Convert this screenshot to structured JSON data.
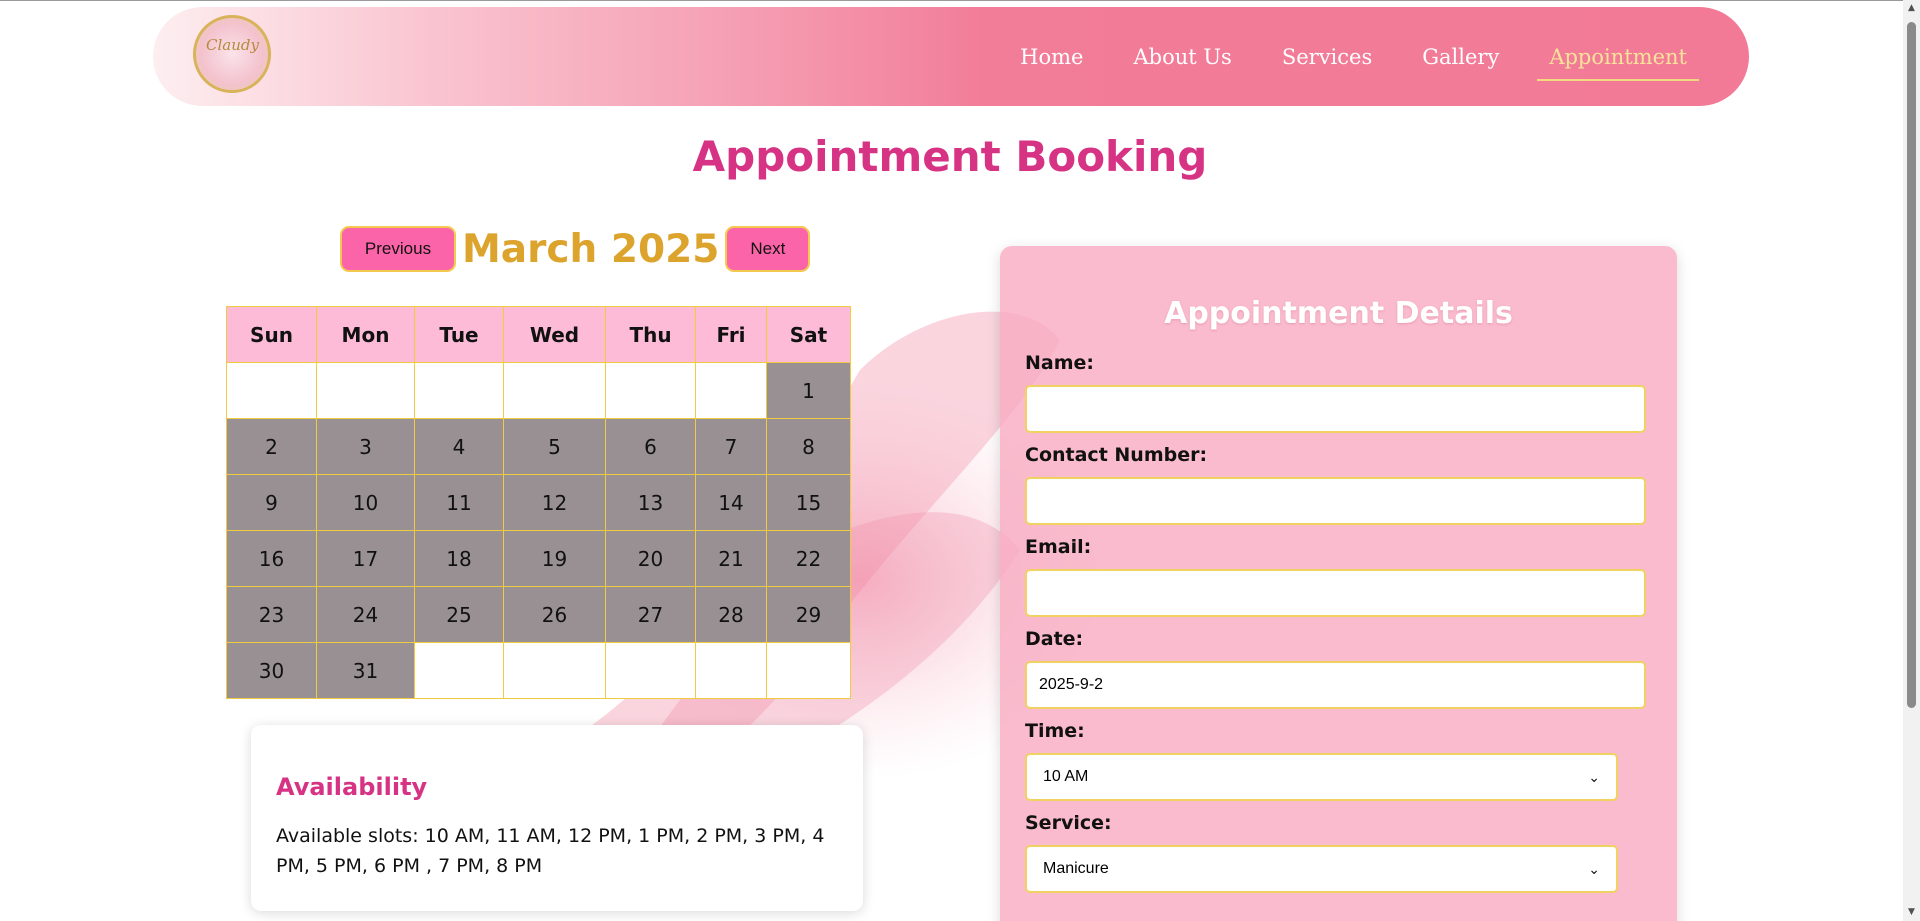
{
  "nav": {
    "logo_text": "Claudy",
    "links": [
      "Home",
      "About Us",
      "Services",
      "Gallery",
      "Appointment"
    ]
  },
  "page": {
    "title": "Appointment Booking"
  },
  "calendar": {
    "prev_label": "Previous",
    "next_label": "Next",
    "month_label": "March 2025",
    "weekdays": [
      "Sun",
      "Mon",
      "Tue",
      "Wed",
      "Thu",
      "Fri",
      "Sat"
    ],
    "weeks": [
      [
        "",
        "",
        "",
        "",
        "",
        "",
        "1"
      ],
      [
        "2",
        "3",
        "4",
        "5",
        "6",
        "7",
        "8"
      ],
      [
        "9",
        "10",
        "11",
        "12",
        "13",
        "14",
        "15"
      ],
      [
        "16",
        "17",
        "18",
        "19",
        "20",
        "21",
        "22"
      ],
      [
        "23",
        "24",
        "25",
        "26",
        "27",
        "28",
        "29"
      ],
      [
        "30",
        "31",
        "",
        "",
        "",
        "",
        ""
      ]
    ]
  },
  "availability": {
    "title": "Availability",
    "text": "Available slots: 10 AM, 11 AM, 12 PM, 1 PM, 2 PM, 3 PM, 4 PM, 5 PM, 6 PM , 7 PM, 8 PM"
  },
  "form": {
    "title": "Appointment Details",
    "name_label": "Name:",
    "name_value": "",
    "contact_label": "Contact Number:",
    "contact_value": "",
    "email_label": "Email:",
    "email_value": "",
    "date_label": "Date:",
    "date_value": "2025-9-2",
    "time_label": "Time:",
    "time_value": "10 AM",
    "service_label": "Service:",
    "service_value": "Manicure"
  },
  "colors": {
    "accent_pink": "#d63384",
    "gold": "#dca32d",
    "button_pink": "#fb64a8",
    "booked_gray": "#989092"
  }
}
